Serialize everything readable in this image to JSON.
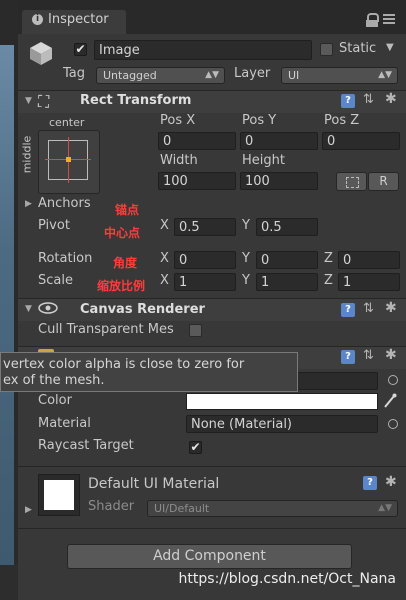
{
  "tab": {
    "title": "Inspector",
    "icon": "info-icon"
  },
  "object": {
    "name": "Image",
    "active": true,
    "static_label": "Static",
    "static": false,
    "tag_label": "Tag",
    "tag_value": "Untagged",
    "layer_label": "Layer",
    "layer_value": "UI"
  },
  "rect_transform": {
    "title": "Rect Transform",
    "anchor_h": "center",
    "anchor_v": "middle",
    "pos_x_label": "Pos X",
    "pos_y_label": "Pos Y",
    "pos_z_label": "Pos Z",
    "pos_x": "0",
    "pos_y": "0",
    "pos_z": "0",
    "width_label": "Width",
    "height_label": "Height",
    "width": "100",
    "height": "100",
    "raw_button": "R",
    "anchors_label": "Anchors",
    "pivot_label": "Pivot",
    "pivot_x": "0.5",
    "pivot_y": "0.5",
    "rotation_label": "Rotation",
    "rot_x": "0",
    "rot_y": "0",
    "rot_z": "0",
    "scale_label": "Scale",
    "scale_x": "1",
    "scale_y": "1",
    "scale_z": "1",
    "x_letter": "X",
    "y_letter": "Y",
    "z_letter": "Z"
  },
  "annotations": {
    "anchors": "锚点",
    "pivot": "中心点",
    "rotation": "角度",
    "scale": "缩放比例"
  },
  "canvas_renderer": {
    "title": "Canvas Renderer",
    "cull_label": "Cull Transparent Mes",
    "cull": false
  },
  "tooltip": {
    "line1": "vertex color alpha is close to zero for",
    "line2": "ex of the mesh."
  },
  "image": {
    "color_label": "Color",
    "color_value": "#ffffff",
    "material_label": "Material",
    "material_value": "None (Material)",
    "raycast_label": "Raycast Target",
    "raycast": true
  },
  "material": {
    "title": "Default UI Material",
    "shader_label": "Shader",
    "shader_value": "UI/Default"
  },
  "add_component": "Add Component",
  "watermark": "https://blog.csdn.net/Oct_Nana"
}
